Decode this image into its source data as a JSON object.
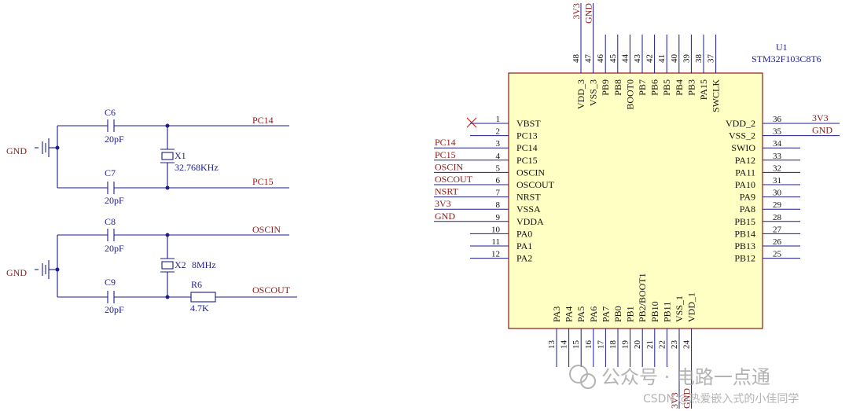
{
  "oscillator_circuit": {
    "gnd_label": "GND",
    "c6": {
      "ref": "C6",
      "value": "20pF"
    },
    "c7": {
      "ref": "C7",
      "value": "20pF"
    },
    "c8": {
      "ref": "C8",
      "value": "20pF"
    },
    "c9": {
      "ref": "C9",
      "value": "20pF"
    },
    "x1": {
      "ref": "X1",
      "value": "32.768KHz"
    },
    "x2": {
      "ref": "X2",
      "value": "8MHz"
    },
    "r6": {
      "ref": "R6",
      "value": "4.7K"
    },
    "nets": {
      "pc14": "PC14",
      "pc15": "PC15",
      "oscin": "OSCIN",
      "oscout": "OSCOUT"
    }
  },
  "mcu": {
    "ref": "U1",
    "part": "STM32F103C8T6",
    "left_pins": [
      {
        "num": "1",
        "name": "VBST",
        "net": ""
      },
      {
        "num": "2",
        "name": "PC13",
        "net": ""
      },
      {
        "num": "3",
        "name": "PC14",
        "net": "PC14"
      },
      {
        "num": "4",
        "name": "PC15",
        "net": "PC15"
      },
      {
        "num": "5",
        "name": "OSCIN",
        "net": "OSCIN"
      },
      {
        "num": "6",
        "name": "OSCOUT",
        "net": "OSCOUT"
      },
      {
        "num": "7",
        "name": "NRST",
        "net": "NSRT"
      },
      {
        "num": "8",
        "name": "VSSA",
        "net": "3V3"
      },
      {
        "num": "9",
        "name": "VDDA",
        "net": "GND"
      },
      {
        "num": "10",
        "name": "PA0",
        "net": ""
      },
      {
        "num": "11",
        "name": "PA1",
        "net": ""
      },
      {
        "num": "12",
        "name": "PA2",
        "net": ""
      }
    ],
    "right_pins": [
      {
        "num": "36",
        "name": "VDD_2",
        "net": "3V3"
      },
      {
        "num": "35",
        "name": "VSS_2",
        "net": "GND"
      },
      {
        "num": "34",
        "name": "SWIO",
        "net": ""
      },
      {
        "num": "33",
        "name": "PA12",
        "net": ""
      },
      {
        "num": "32",
        "name": "PA11",
        "net": ""
      },
      {
        "num": "31",
        "name": "PA10",
        "net": ""
      },
      {
        "num": "30",
        "name": "PA9",
        "net": ""
      },
      {
        "num": "29",
        "name": "PA8",
        "net": ""
      },
      {
        "num": "28",
        "name": "PB15",
        "net": ""
      },
      {
        "num": "27",
        "name": "PB14",
        "net": ""
      },
      {
        "num": "26",
        "name": "PB13",
        "net": ""
      },
      {
        "num": "25",
        "name": "PB12",
        "net": ""
      }
    ],
    "top_pins": [
      {
        "num": "48",
        "name": "VDD_3",
        "net": "3V3"
      },
      {
        "num": "47",
        "name": "VSS_3",
        "net": "GND"
      },
      {
        "num": "46",
        "name": "PB9",
        "net": ""
      },
      {
        "num": "45",
        "name": "PB8",
        "net": ""
      },
      {
        "num": "44",
        "name": "BOOT0",
        "net": ""
      },
      {
        "num": "43",
        "name": "PB7",
        "net": ""
      },
      {
        "num": "42",
        "name": "PB6",
        "net": ""
      },
      {
        "num": "41",
        "name": "PB5",
        "net": ""
      },
      {
        "num": "40",
        "name": "PB4",
        "net": ""
      },
      {
        "num": "39",
        "name": "PB3",
        "net": ""
      },
      {
        "num": "38",
        "name": "PA15",
        "net": ""
      },
      {
        "num": "37",
        "name": "SWCLK",
        "net": ""
      }
    ],
    "bottom_pins": [
      {
        "num": "13",
        "name": "PA3",
        "net": ""
      },
      {
        "num": "14",
        "name": "PA4",
        "net": ""
      },
      {
        "num": "15",
        "name": "PA5",
        "net": ""
      },
      {
        "num": "16",
        "name": "PA6",
        "net": ""
      },
      {
        "num": "17",
        "name": "PA7",
        "net": ""
      },
      {
        "num": "18",
        "name": "PB0",
        "net": ""
      },
      {
        "num": "19",
        "name": "PB1",
        "net": ""
      },
      {
        "num": "20",
        "name": "PB2/BOOT1",
        "net": ""
      },
      {
        "num": "21",
        "name": "PB10",
        "net": ""
      },
      {
        "num": "22",
        "name": "PB11",
        "net": ""
      },
      {
        "num": "23",
        "name": "VSS_1",
        "net": "3V3"
      },
      {
        "num": "24",
        "name": "VDD_1",
        "net": "GND"
      }
    ]
  },
  "watermark": {
    "channel": "公众号 · 电路一点通",
    "csdn": "CSDN @热爱嵌入式的小佳同学"
  },
  "colors": {
    "wire": "#1c1c8c",
    "net_label": "#8b1a1a",
    "chip_fill": "#ffffc4",
    "chip_border": "#8b1a1a"
  }
}
